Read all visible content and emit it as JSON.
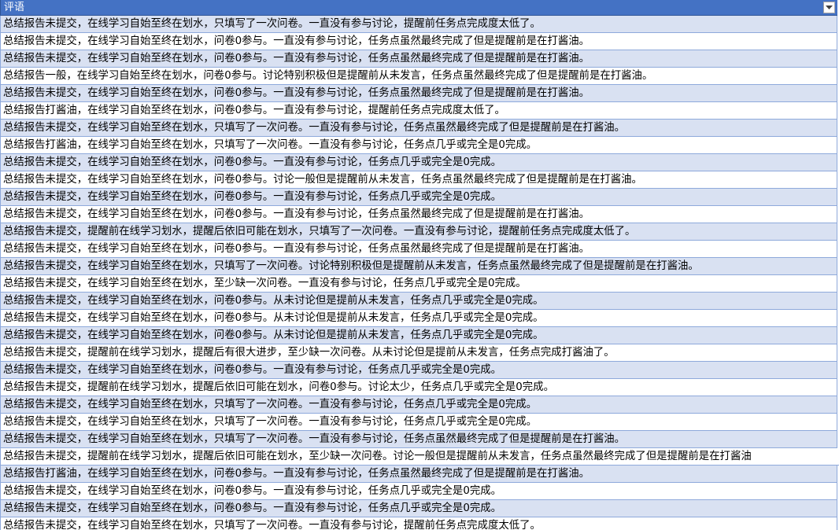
{
  "column": {
    "header": "评语",
    "filter_icon": "dropdown-arrow-icon"
  },
  "colors": {
    "header_bg": "#4472c4",
    "band": "#d9e1f2",
    "border": "#8ea9db"
  },
  "rows": [
    "总结报告未提交，在线学习自始至终在划水，只填写了一次问卷。一直没有参与讨论，提醒前任务点完成度太低了。",
    "总结报告未提交，在线学习自始至终在划水，问卷0参与。一直没有参与讨论，任务点虽然最终完成了但是提醒前是在打酱油。",
    "总结报告未提交，在线学习自始至终在划水，问卷0参与。一直没有参与讨论，任务点虽然最终完成了但是提醒前是在打酱油。",
    "总结报告一般，在线学习自始至终在划水，问卷0参与。讨论特别积极但是提醒前从未发言，任务点虽然最终完成了但是提醒前是在打酱油。",
    "总结报告未提交，在线学习自始至终在划水，问卷0参与。一直没有参与讨论，任务点虽然最终完成了但是提醒前是在打酱油。",
    "总结报告打酱油，在线学习自始至终在划水，问卷0参与。一直没有参与讨论，提醒前任务点完成度太低了。",
    "总结报告未提交，在线学习自始至终在划水，只填写了一次问卷。一直没有参与讨论，任务点虽然最终完成了但是提醒前是在打酱油。",
    "总结报告打酱油，在线学习自始至终在划水，只填写了一次问卷。一直没有参与讨论，任务点几乎或完全是0完成。",
    "总结报告未提交，在线学习自始至终在划水，问卷0参与。一直没有参与讨论，任务点几乎或完全是0完成。",
    "总结报告未提交，在线学习自始至终在划水，问卷0参与。讨论一般但是提醒前从未发言，任务点虽然最终完成了但是提醒前是在打酱油。",
    "总结报告未提交，在线学习自始至终在划水，问卷0参与。一直没有参与讨论，任务点几乎或完全是0完成。",
    "总结报告未提交，在线学习自始至终在划水，问卷0参与。一直没有参与讨论，任务点虽然最终完成了但是提醒前是在打酱油。",
    "总结报告未提交，提醒前在线学习划水，提醒后依旧可能在划水，只填写了一次问卷。一直没有参与讨论，提醒前任务点完成度太低了。",
    "总结报告未提交，在线学习自始至终在划水，问卷0参与。一直没有参与讨论，任务点虽然最终完成了但是提醒前是在打酱油。",
    "总结报告未提交，在线学习自始至终在划水，只填写了一次问卷。讨论特别积极但是提醒前从未发言，任务点虽然最终完成了但是提醒前是在打酱油。",
    "总结报告未提交，在线学习自始至终在划水，至少缺一次问卷。一直没有参与讨论，任务点几乎或完全是0完成。",
    "总结报告未提交，在线学习自始至终在划水，问卷0参与。从未讨论但是提前从未发言，任务点几乎或完全是0完成。",
    "总结报告未提交，在线学习自始至终在划水，问卷0参与。从未讨论但是提前从未发言，任务点几乎或完全是0完成。",
    "总结报告未提交，在线学习自始至终在划水，问卷0参与。从未讨论但是提前从未发言，任务点几乎或完全是0完成。",
    "总结报告未提交，提醒前在线学习划水，提醒后有很大进步，至少缺一次问卷。从未讨论但是提前从未发言，任务点完成打酱油了。",
    "总结报告未提交，在线学习自始至终在划水，问卷0参与。一直没有参与讨论，任务点几乎或完全是0完成。",
    "总结报告未提交，提醒前在线学习划水，提醒后依旧可能在划水，问卷0参与。讨论太少，任务点几乎或完全是0完成。",
    "总结报告未提交，在线学习自始至终在划水，只填写了一次问卷。一直没有参与讨论，任务点几乎或完全是0完成。",
    "总结报告未提交，在线学习自始至终在划水，只填写了一次问卷。一直没有参与讨论，任务点几乎或完全是0完成。",
    "总结报告未提交，在线学习自始至终在划水，只填写了一次问卷。一直没有参与讨论，任务点虽然最终完成了但是提醒前是在打酱油。",
    "总结报告未提交，提醒前在线学习划水，提醒后依旧可能在划水，至少缺一次问卷。讨论一般但是提醒前从未发言，任务点虽然最终完成了但是提醒前是在打酱油",
    "总结报告打酱油，在线学习自始至终在划水，问卷0参与。一直没有参与讨论，任务点虽然最终完成了但是提醒前是在打酱油。",
    "总结报告未提交，在线学习自始至终在划水，问卷0参与。一直没有参与讨论，任务点几乎或完全是0完成。",
    "总结报告未提交，在线学习自始至终在划水，问卷0参与。一直没有参与讨论，任务点几乎或完全是0完成。",
    "总结报告未提交，在线学习自始至终在划水，只填写了一次问卷。一直没有参与讨论，提醒前任务点完成度太低了。"
  ]
}
